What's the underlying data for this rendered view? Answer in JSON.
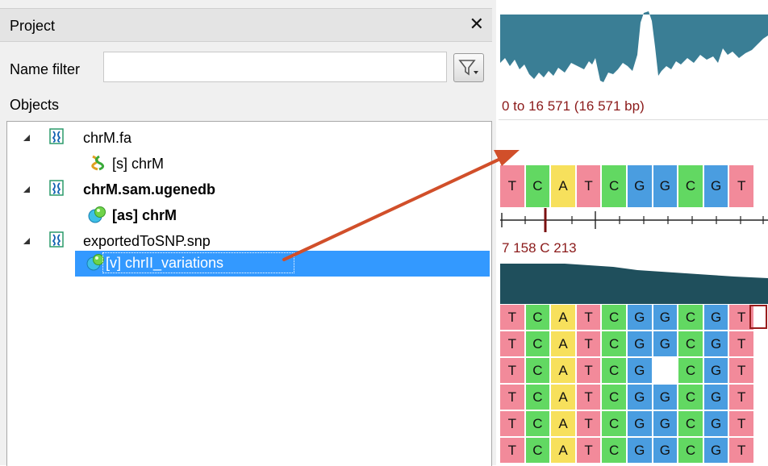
{
  "panel": {
    "title": "Project",
    "close_glyph": "✕",
    "name_filter_label": "Name filter",
    "name_filter_value": "",
    "name_filter_placeholder": "",
    "objects_label": "Objects"
  },
  "tree": {
    "items": [
      {
        "label": "chrM.fa",
        "bold": false,
        "icon": "document-icon"
      },
      {
        "label": "[s] chrM",
        "bold": false,
        "icon": "sequence-icon"
      },
      {
        "label": "chrM.sam.ugenedb",
        "bold": true,
        "icon": "document-icon"
      },
      {
        "label": "[as] chrM",
        "bold": true,
        "icon": "assembly-icon"
      },
      {
        "label": "exportedToSNP.snp",
        "bold": false,
        "icon": "document-icon"
      },
      {
        "label": "[v] chrII_variations",
        "bold": false,
        "icon": "variations-icon",
        "selected": true
      }
    ]
  },
  "view": {
    "range_label": "0 to 16 571 (16 571 bp)",
    "position_label": "7 158 C 213",
    "consensus": [
      "T",
      "C",
      "A",
      "T",
      "C",
      "G",
      "G",
      "C",
      "G",
      "T"
    ],
    "reads": [
      [
        "T",
        "C",
        "A",
        "T",
        "C",
        "G",
        "G",
        "C",
        "G",
        "T"
      ],
      [
        "T",
        "C",
        "A",
        "T",
        "C",
        "G",
        "G",
        "C",
        "G",
        "T"
      ],
      [
        "T",
        "C",
        "A",
        "T",
        "C",
        "G",
        "",
        "C",
        "G",
        "T"
      ],
      [
        "T",
        "C",
        "A",
        "T",
        "C",
        "G",
        "G",
        "C",
        "G",
        "T"
      ],
      [
        "T",
        "C",
        "A",
        "T",
        "C",
        "G",
        "G",
        "C",
        "G",
        "T"
      ],
      [
        "T",
        "C",
        "A",
        "T",
        "C",
        "G",
        "G",
        "C",
        "G",
        "T"
      ]
    ]
  },
  "colors": {
    "A": "#f7e05c",
    "C": "#62d862",
    "G": "#4a9de0",
    "T": "#f28a9a",
    "selection": "#3399ff",
    "coverage": "#3a7e95",
    "arrow": "#d14f2a",
    "position_text": "#8b1a1a"
  }
}
